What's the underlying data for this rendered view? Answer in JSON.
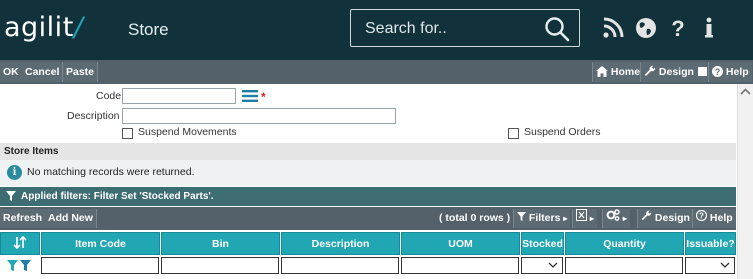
{
  "header": {
    "logo": "agilit",
    "logo_slash": "/",
    "module_title": "Store",
    "search_placeholder": "Search for..",
    "icons": [
      "rss-icon",
      "globe-icon",
      "help-icon",
      "info-icon"
    ]
  },
  "actions": {
    "ok": "OK",
    "cancel": "Cancel",
    "paste": "Paste",
    "home": "Home",
    "design": "Design",
    "help": "Help"
  },
  "form": {
    "code_label": "Code",
    "code_value": "",
    "description_label": "Description",
    "description_value": "",
    "required_mark": "*",
    "suspend_movements_label": "Suspend Movements",
    "suspend_orders_label": "Suspend Orders"
  },
  "section": {
    "title": "Store Items",
    "message": "No matching records were returned.",
    "filter_text": "Applied filters: Filter Set 'Stocked Parts'."
  },
  "grid": {
    "refresh": "Refresh",
    "add_new": "Add New",
    "total": "( total 0 rows )",
    "filters": "Filters",
    "design": "Design",
    "help": "Help",
    "columns": [
      "Item Code",
      "Bin",
      "Description",
      "UOM",
      "Stocked",
      "Quantity",
      "Issuable?"
    ]
  },
  "colors": {
    "header_bg": "#11323a",
    "toolbar_bg": "#54616a",
    "grid_header": "#21a6b4",
    "filter_bar": "#3d6c73",
    "accent": "#2a8c9e"
  }
}
